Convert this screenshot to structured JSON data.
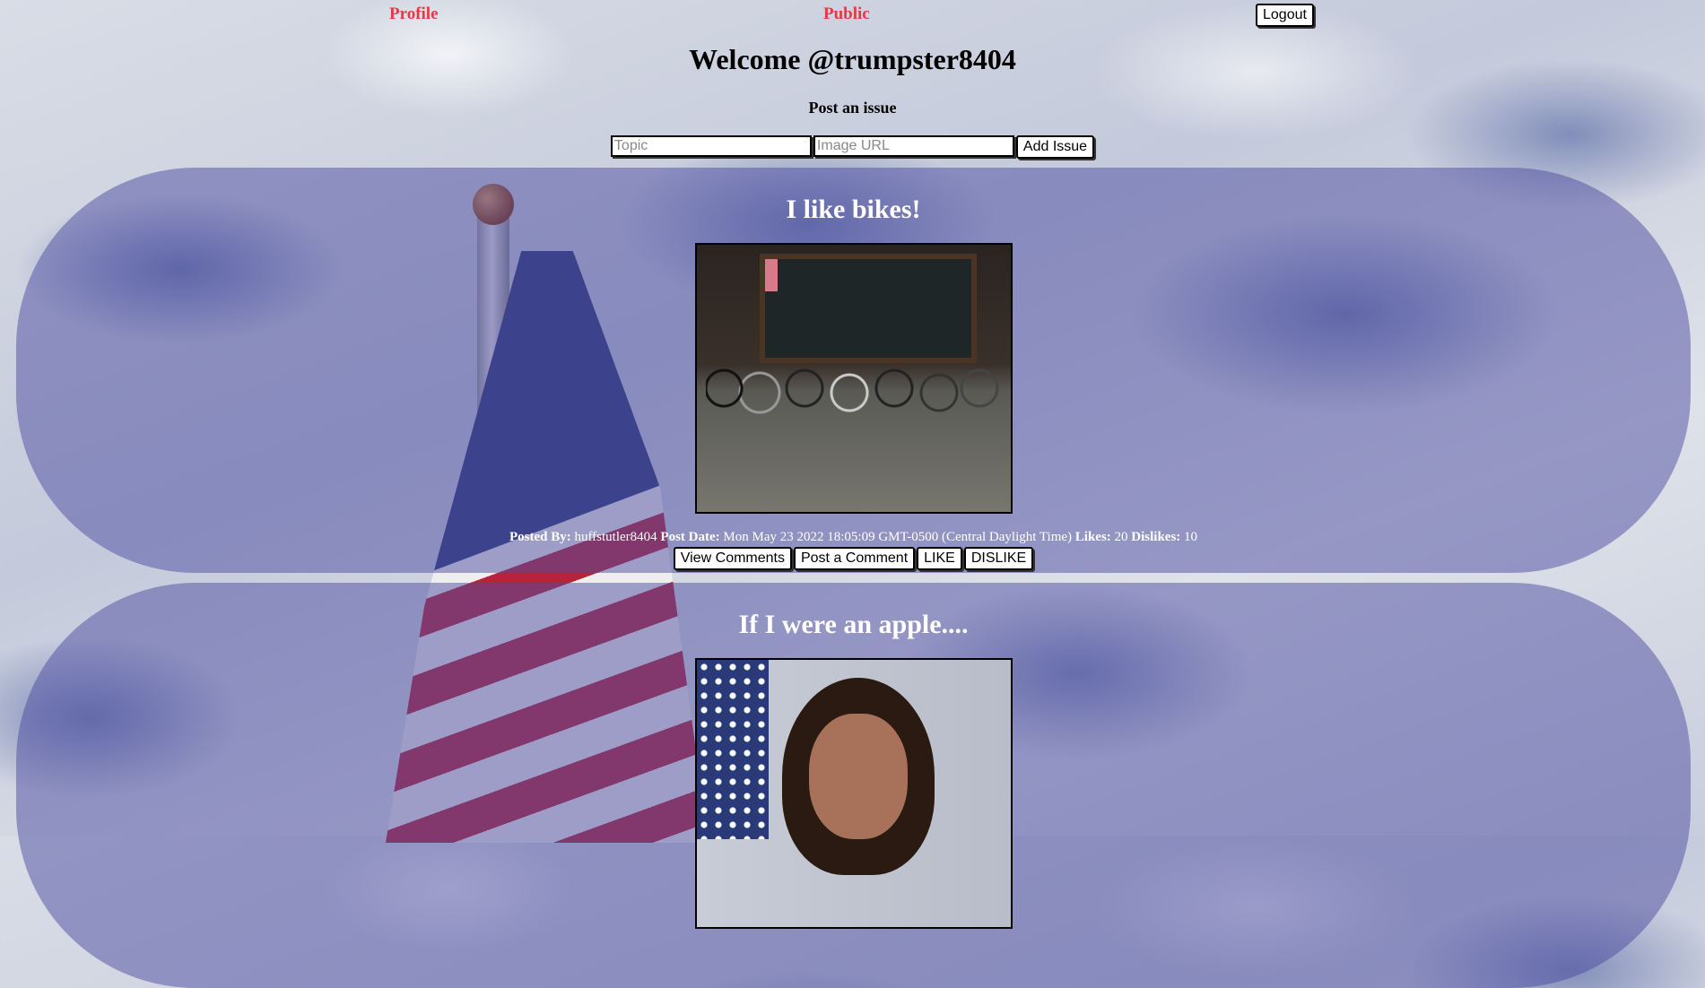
{
  "nav": {
    "profile": "Profile",
    "public": "Public",
    "logout": "Logout"
  },
  "header": {
    "welcome": "Welcome @trumpster8404",
    "post_label": "Post an issue"
  },
  "form": {
    "topic_placeholder": "Topic",
    "image_placeholder": "Image URL",
    "add_button": "Add Issue"
  },
  "posts": [
    {
      "title": "I like bikes!",
      "posted_by_label": "Posted By:",
      "posted_by": "huffstutler8404",
      "date_label": "Post Date:",
      "date": "Mon May 23 2022 18:05:09 GMT-0500 (Central Daylight Time)",
      "likes_label": "Likes:",
      "likes": "20",
      "dislikes_label": "Dislikes:",
      "dislikes": "10",
      "view_comments": "View Comments",
      "post_comment": "Post a Comment",
      "like": "LIKE",
      "dislike": "DISLIKE"
    },
    {
      "title": "If I were an apple...."
    }
  ],
  "colors": {
    "nav_link": "#e53945",
    "card_bg": "rgba(75,75,160,0.5)"
  }
}
